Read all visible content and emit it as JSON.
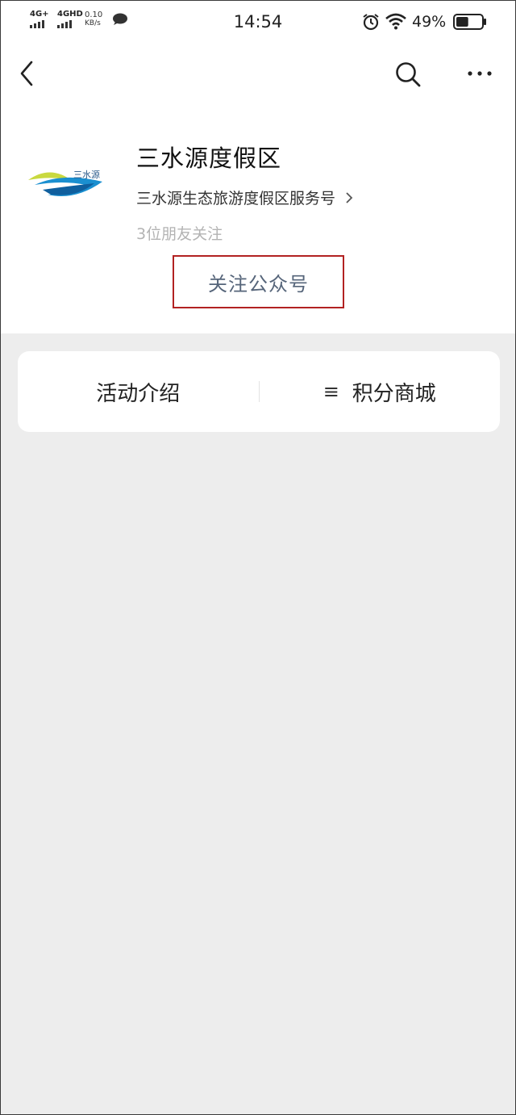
{
  "status": {
    "signal1_label": "4G+",
    "signal2_label": "4GHD",
    "net_speed_value": "0.10",
    "net_speed_unit": "KB/s",
    "time": "14:54",
    "battery_text": "49%",
    "battery_level": 0.49
  },
  "profile": {
    "logo_text": "三水源",
    "name": "三水源度假区",
    "description": "三水源生态旅游度假区服务号",
    "friends_following": "3位朋友关注",
    "follow_button": "关注公众号",
    "highlight_color": "#b22222"
  },
  "menu": {
    "items": [
      {
        "label": "活动介绍",
        "icon": ""
      },
      {
        "label": "积分商城",
        "icon": "≡"
      }
    ]
  }
}
